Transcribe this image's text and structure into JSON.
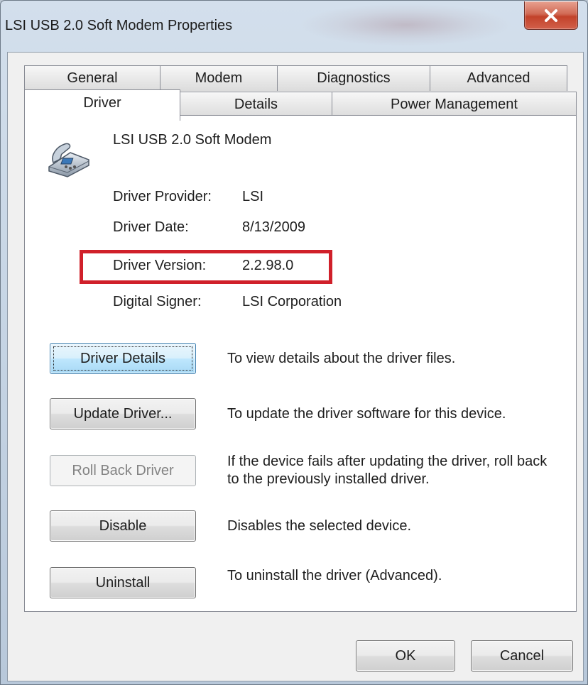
{
  "window": {
    "title": "LSI USB 2.0 Soft Modem Properties"
  },
  "tabs": {
    "row1": [
      "General",
      "Modem",
      "Diagnostics",
      "Advanced"
    ],
    "row2": [
      "Driver",
      "Details",
      "Power Management"
    ],
    "active": "Driver"
  },
  "device": {
    "name": "LSI USB 2.0 Soft Modem",
    "icon": "telephone-modem-icon"
  },
  "info": [
    {
      "label": "Driver Provider:",
      "value": "LSI"
    },
    {
      "label": "Driver Date:",
      "value": "8/13/2009"
    },
    {
      "label": "Driver Version:",
      "value": "2.2.98.0"
    },
    {
      "label": "Digital Signer:",
      "value": "LSI Corporation"
    }
  ],
  "actions": [
    {
      "label": "Driver Details",
      "description": "To view details about the driver files."
    },
    {
      "label": "Update Driver...",
      "description": "To update the driver software for this device."
    },
    {
      "label": "Roll Back Driver",
      "description": "If the device fails after updating the driver, roll back to the previously installed driver.",
      "disabled": true
    },
    {
      "label": "Disable",
      "description": "Disables the selected device."
    },
    {
      "label": "Uninstall",
      "description": "To uninstall the driver (Advanced)."
    }
  ],
  "footer": {
    "ok_label": "OK",
    "cancel_label": "Cancel"
  },
  "colors": {
    "highlight": "#d0202a",
    "close_button": "#c2422a",
    "focus_button": "#bee6fd"
  }
}
